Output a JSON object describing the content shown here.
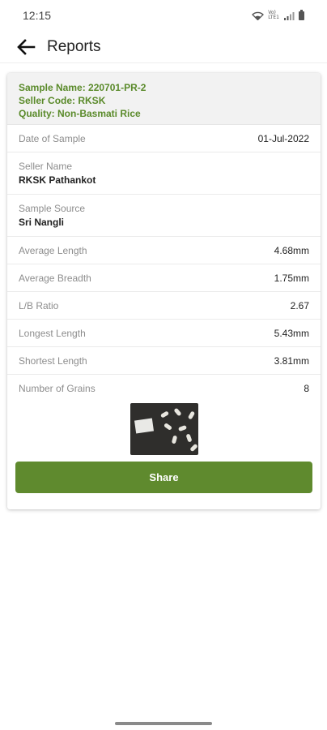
{
  "status_bar": {
    "time": "12:15",
    "volte_label": "Vo)\nLTE1"
  },
  "header": {
    "title": "Reports"
  },
  "report": {
    "sample_name": "Sample Name: 220701-PR-2",
    "seller_code": "Seller Code: RKSK",
    "quality": "Quality: Non-Basmati Rice",
    "rows": [
      {
        "label": "Date of Sample",
        "value": "01-Jul-2022"
      },
      {
        "label": "Seller Name",
        "value": "RKSK Pathankot"
      },
      {
        "label": "Sample Source",
        "value": "Sri Nangli"
      },
      {
        "label": "Average Length",
        "value": "4.68mm"
      },
      {
        "label": "Average Breadth",
        "value": "1.75mm"
      },
      {
        "label": "L/B Ratio",
        "value": "2.67"
      },
      {
        "label": "Longest Length",
        "value": "5.43mm"
      },
      {
        "label": "Shortest Length",
        "value": "3.81mm"
      },
      {
        "label": "Number of Grains",
        "value": "8"
      }
    ],
    "share_label": "Share"
  },
  "colors": {
    "accent": "#5f8a2e",
    "accent_text": "#5a8a2a"
  },
  "icons": {
    "back": "arrow-left-icon",
    "wifi": "wifi-icon",
    "signal": "signal-icon",
    "battery": "battery-icon"
  }
}
